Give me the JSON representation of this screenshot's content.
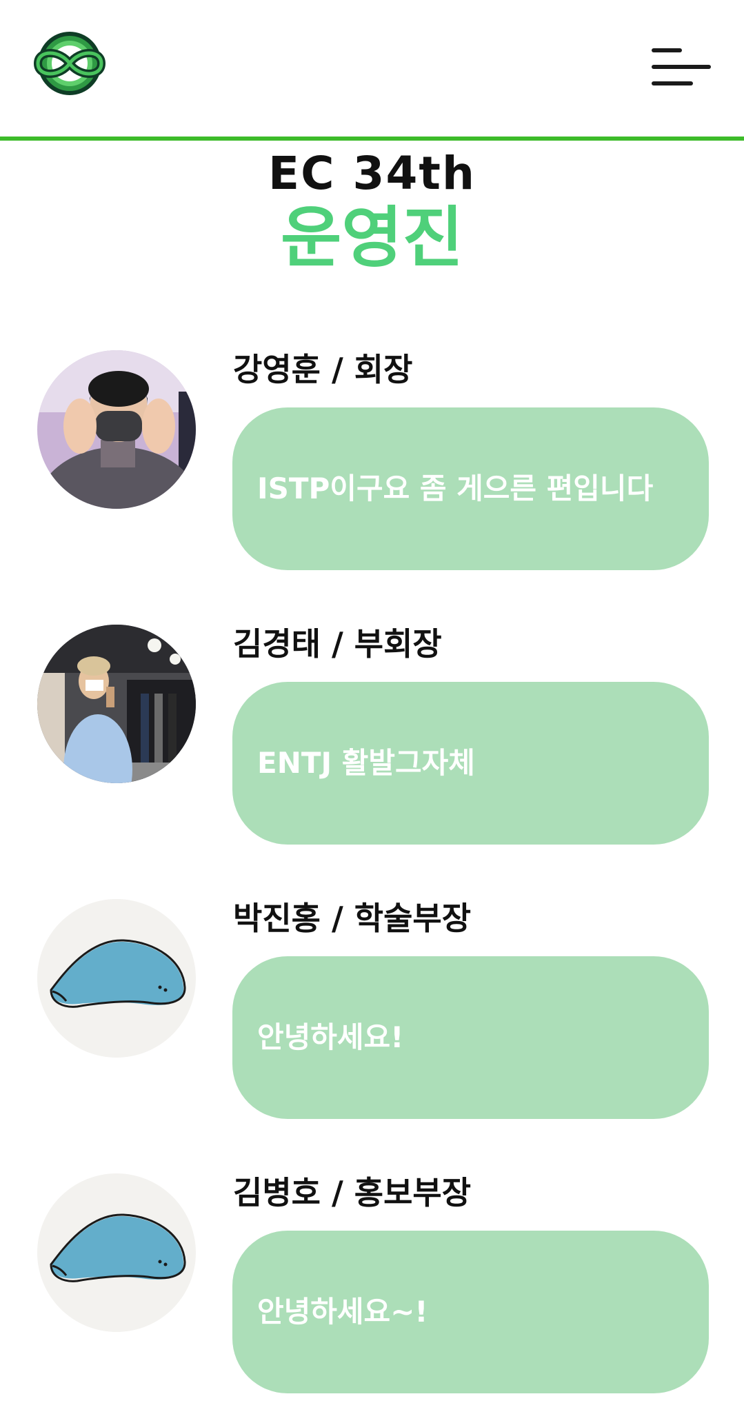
{
  "header": {
    "logo_icon": "infinity-logo-icon",
    "menu_icon": "hamburger-menu-icon",
    "accent_color": "#3dbb2a"
  },
  "title": {
    "line1": "EC 34th",
    "line2": "운영진",
    "line2_color": "#4fd07a"
  },
  "members": [
    {
      "name": "강영훈 / 회장",
      "intro": "ISTP이구요 좀 게으른 편입니다",
      "avatar": "photo-person-masked"
    },
    {
      "name": "김경태 / 부회장",
      "intro": "ENTJ 활발그자체",
      "avatar": "photo-person-store"
    },
    {
      "name": "박진홍 / 학술부장",
      "intro": "안녕하세요!",
      "avatar": "default-whale-avatar"
    },
    {
      "name": "김병호 / 홍보부장",
      "intro": "안녕하세요~!",
      "avatar": "default-whale-avatar"
    }
  ],
  "colors": {
    "bubble": "#acdeb8",
    "bubble_text": "#ffffff"
  }
}
